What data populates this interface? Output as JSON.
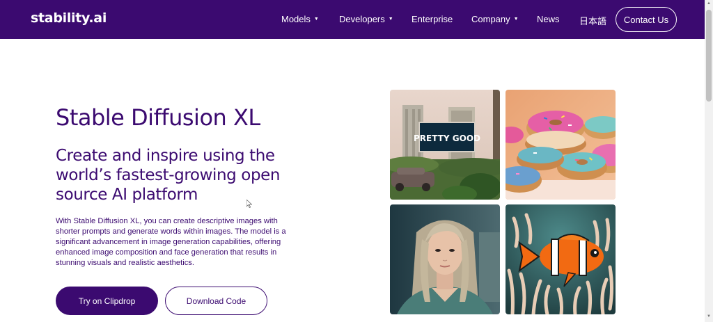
{
  "brand": {
    "logo": "stability.ai",
    "primary_color": "#3b0a70"
  },
  "nav": {
    "items": [
      {
        "label": "Models",
        "dropdown": true
      },
      {
        "label": "Developers",
        "dropdown": true
      },
      {
        "label": "Enterprise",
        "dropdown": false
      },
      {
        "label": "Company",
        "dropdown": true
      },
      {
        "label": "News",
        "dropdown": false
      },
      {
        "label": "日本語",
        "dropdown": false
      }
    ],
    "caret": "▼",
    "contact_label": "Contact Us"
  },
  "hero": {
    "title": "Stable Diffusion XL",
    "subtitle": "Create and inspire using the world’s fastest-growing open source AI platform",
    "description": "With Stable Diffusion XL, you can create descriptive images with shorter prompts and generate words within images. The model is a significant advancement in image generation capabilities, offering enhanced image composition and face generation that results in stunning visuals and realistic aesthetics.",
    "primary_button": "Try on Clipdrop",
    "secondary_button": "Download Code"
  },
  "gallery": {
    "billboard_text": "PRETTY GOOD",
    "tiles": [
      {
        "subject": "billboard-city"
      },
      {
        "subject": "donuts"
      },
      {
        "subject": "portrait-woman"
      },
      {
        "subject": "clownfish"
      }
    ]
  }
}
